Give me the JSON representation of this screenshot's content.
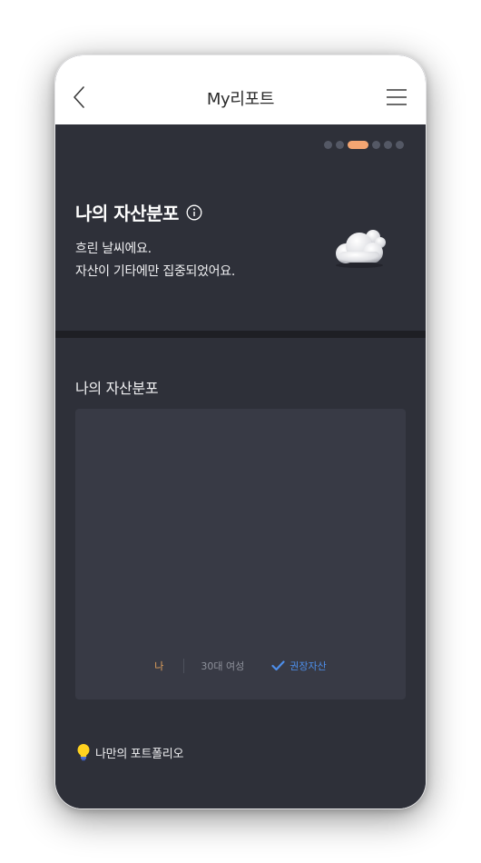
{
  "header": {
    "title": "My리포트",
    "back_icon": "chevron-left-icon",
    "menu_icon": "hamburger-menu-icon"
  },
  "pager": {
    "total": 6,
    "active_index": 2,
    "active_color": "#f3a572"
  },
  "summary": {
    "title": "나의 자산분포",
    "info_icon": "info-circle-icon",
    "weather_line1": "흐린 날씨에요.",
    "weather_line2": "자산이 기타에만 집중되었어요.",
    "weather_icon": "cloud-icon"
  },
  "distribution": {
    "title": "나의 자산분포",
    "legend": {
      "me": "나",
      "peer": "30대 여성",
      "recommended": "권장자산",
      "recommended_icon": "checkmark-icon"
    }
  },
  "portfolio": {
    "label": "나만의 포트폴리오",
    "icon": "lightbulb-icon"
  },
  "colors": {
    "background": "#2e3039",
    "card": "#383a45",
    "accent": "#f3a572",
    "me": "#e3a25c",
    "recommended": "#4d8eea"
  }
}
